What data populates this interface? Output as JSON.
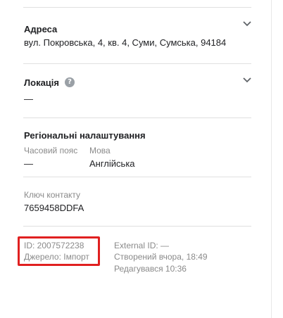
{
  "address": {
    "title": "Адреса",
    "value": "вул. Покровська, 4, кв. 4, Суми, Сумська, 94184",
    "toggle_icon": "chevron-down-icon"
  },
  "location": {
    "title": "Локація",
    "help_icon": "help-icon",
    "help_glyph": "?",
    "value": "—",
    "toggle_icon": "chevron-down-icon"
  },
  "regional": {
    "title": "Регіональні налаштування",
    "timezone_label": "Часовий пояс",
    "timezone_value": "—",
    "language_label": "Мова",
    "language_value": "Англійська"
  },
  "contact_key": {
    "label": "Ключ контакту",
    "value": "7659458DDFA"
  },
  "meta": {
    "id": "ID: 2007572238",
    "source": "Джерело:  Імпорт",
    "external_id": "External ID: —",
    "created": "Створений вчора, 18:49",
    "edited": "Редагувався 10:36"
  },
  "colors": {
    "highlight": "#e02020",
    "muted_text": "#8a8a8a",
    "primary_text": "#202124"
  }
}
